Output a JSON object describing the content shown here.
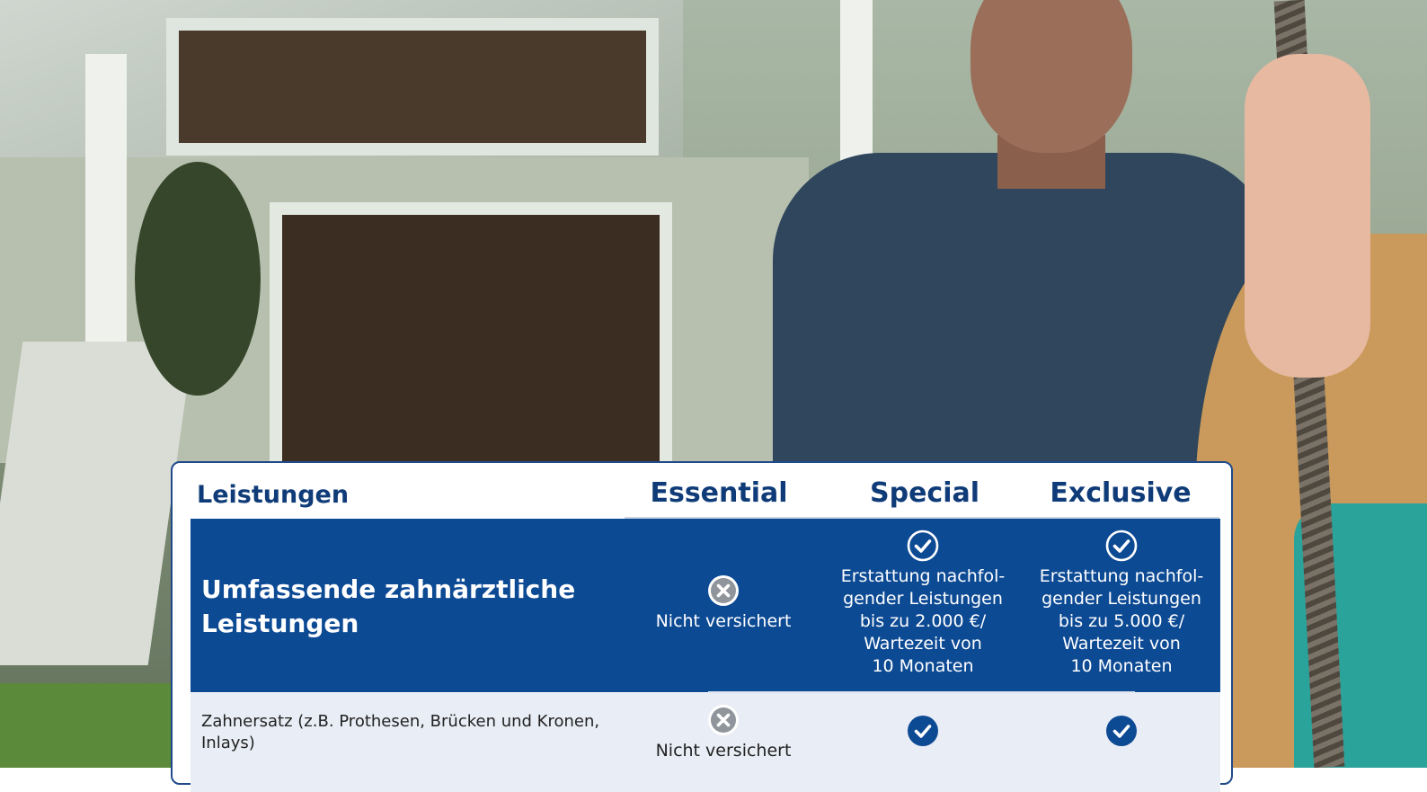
{
  "table": {
    "col_header": "Leistungen",
    "plans": [
      "Essential",
      "Special",
      "Exclusive"
    ],
    "row_main": {
      "title": "Umfassende zahnärztliche Leistungen",
      "essential": "Nicht versichert",
      "special": [
        "Erstattung nachfol-",
        "gender Leistungen",
        "bis zu 2.000 €/",
        "Wartezeit von",
        "10 Monaten"
      ],
      "exclusive": [
        "Erstattung nachfol-",
        "gender Leistungen",
        "bis zu 5.000 €/",
        "Wartezeit von",
        "10 Monaten"
      ]
    },
    "row_sub": {
      "title": "Zahnersatz (z.B. Prothesen, Brücken und Kronen, Inlays)",
      "essential": "Nicht versichert"
    }
  },
  "icons": {
    "cross": "cross-circle-icon",
    "check": "check-circle-icon"
  },
  "colors": {
    "brand_blue": "#0d4a94",
    "header_text": "#0f3c78",
    "cross_gray": "#8f959b"
  }
}
